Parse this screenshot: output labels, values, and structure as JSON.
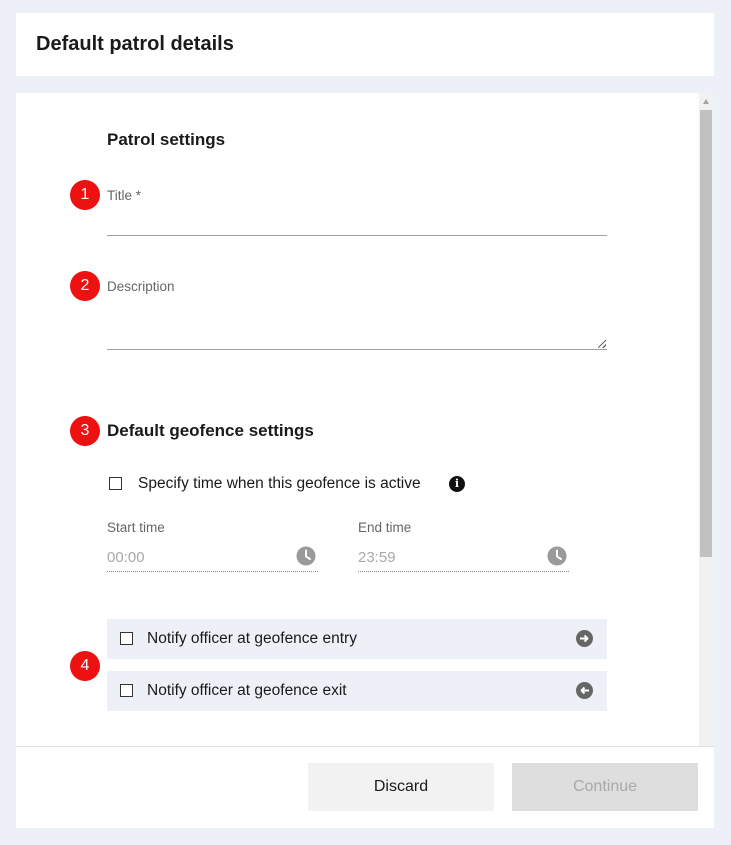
{
  "header": {
    "title": "Default patrol details"
  },
  "patrol_settings": {
    "title": "Patrol settings",
    "title_label": "Title *",
    "title_value": "",
    "description_label": "Description",
    "description_value": ""
  },
  "geofence": {
    "title": "Default geofence settings",
    "specify_time_label": "Specify time when this geofence is active",
    "specify_time_checked": false,
    "start_time_label": "Start time",
    "start_time_value": "00:00",
    "end_time_label": "End time",
    "end_time_value": "23:59",
    "notify_entry_label": "Notify officer at geofence entry",
    "notify_exit_label": "Notify officer at geofence exit"
  },
  "markers": [
    "1",
    "2",
    "3",
    "4"
  ],
  "icons": {
    "info": "info-icon",
    "clock": "clock-icon",
    "entry": "arrow-right-circle-icon",
    "exit": "arrow-left-circle-icon"
  },
  "footer": {
    "discard_label": "Discard",
    "continue_label": "Continue"
  },
  "colors": {
    "marker": "#ee1111",
    "background": "#eef0f8",
    "disabled_button": "#dedede"
  }
}
